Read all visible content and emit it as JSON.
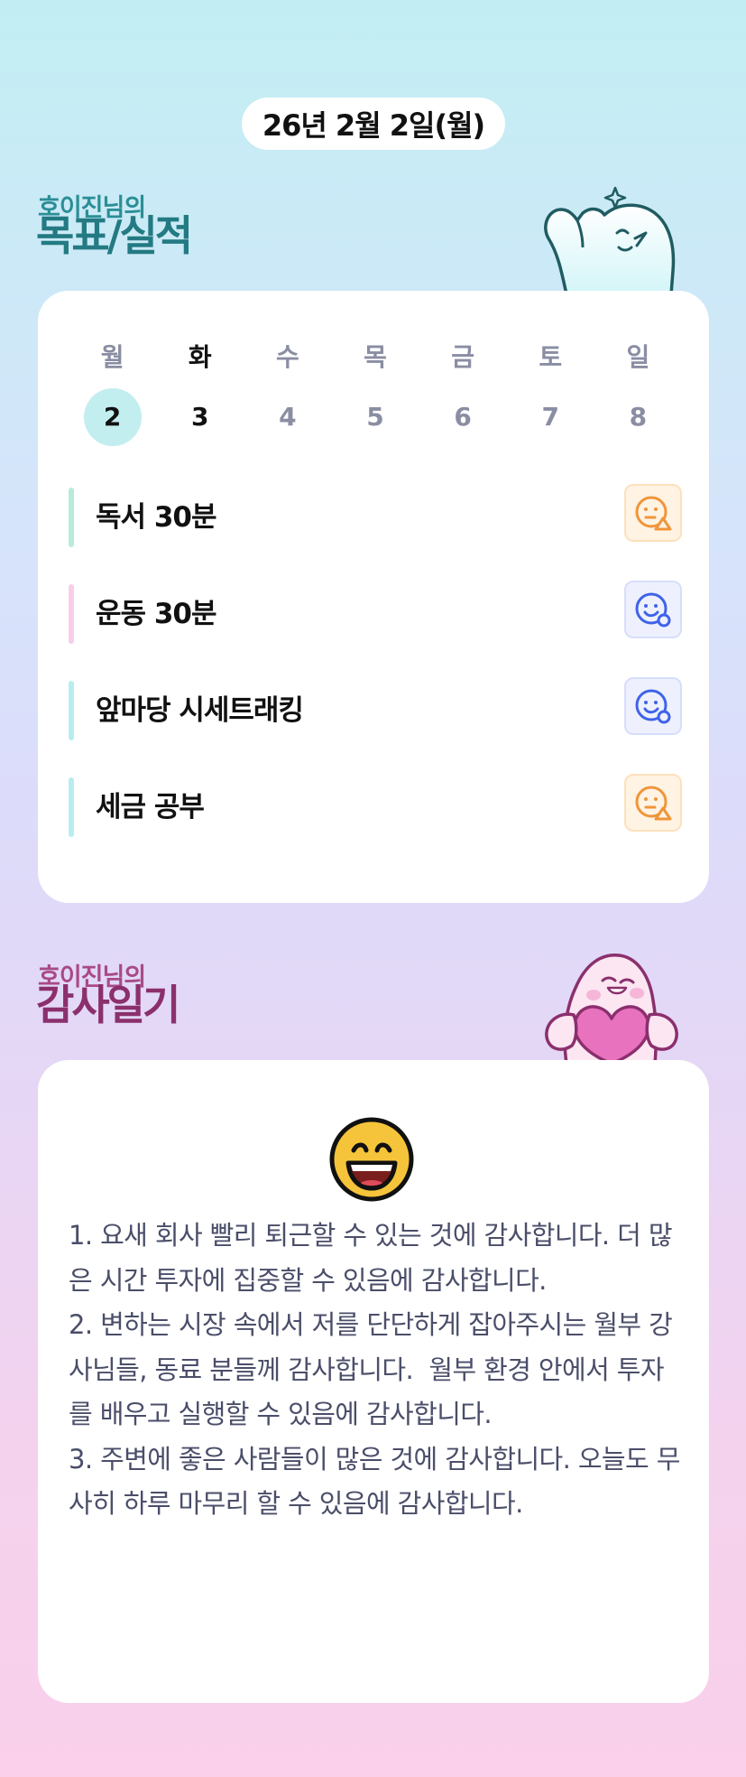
{
  "header": {
    "date": "26년 2월 2일(월)"
  },
  "goals_section": {
    "subtitle": "호이진님의",
    "title": "목표/실적",
    "weekdays": [
      "월",
      "화",
      "수",
      "목",
      "금",
      "토",
      "일"
    ],
    "dates": [
      "2",
      "3",
      "4",
      "5",
      "6",
      "7",
      "8"
    ],
    "selected_index": 0,
    "today_index": 1,
    "items": [
      {
        "label": "독서 30분",
        "bar_color": "#b6ecd8",
        "status_icon": "neutral-face-triangle-icon",
        "status_color": "#f0953a"
      },
      {
        "label": "운동 30분",
        "bar_color": "#f8cde8",
        "status_icon": "smile-face-circle-icon",
        "status_color": "#3f63e8"
      },
      {
        "label": "앞마당 시세트래킹",
        "bar_color": "#b8ecf0",
        "status_icon": "smile-face-circle-icon",
        "status_color": "#3f63e8"
      },
      {
        "label": "세금 공부",
        "bar_color": "#b8ecf0",
        "status_icon": "neutral-face-triangle-icon",
        "status_color": "#f0953a"
      }
    ]
  },
  "diary_section": {
    "subtitle": "호이진님의",
    "title": "감사일기",
    "mood_icon": "grinning-face-icon",
    "text": "1. 요새 회사 빨리 퇴근할 수 있는 것에 감사합니다. 더 많은 시간 투자에 집중할 수 있음에 감사합니다.\n2. 변하는 시장 속에서 저를 단단하게 잡아주시는 월부 강사님들, 동료 분들께 감사합니다.  월부 환경 안에서 투자를 배우고 실행할 수 있음에 감사합니다.\n3. 주변에 좋은 사람들이 많은 것에 감사합니다. 오늘도 무사히 하루 마무리 할 수 있음에 감사합니다."
  },
  "colors": {
    "goal_title": "#237a82",
    "diary_title": "#8b2f6d",
    "selected_date_bg": "#c3eef0"
  }
}
